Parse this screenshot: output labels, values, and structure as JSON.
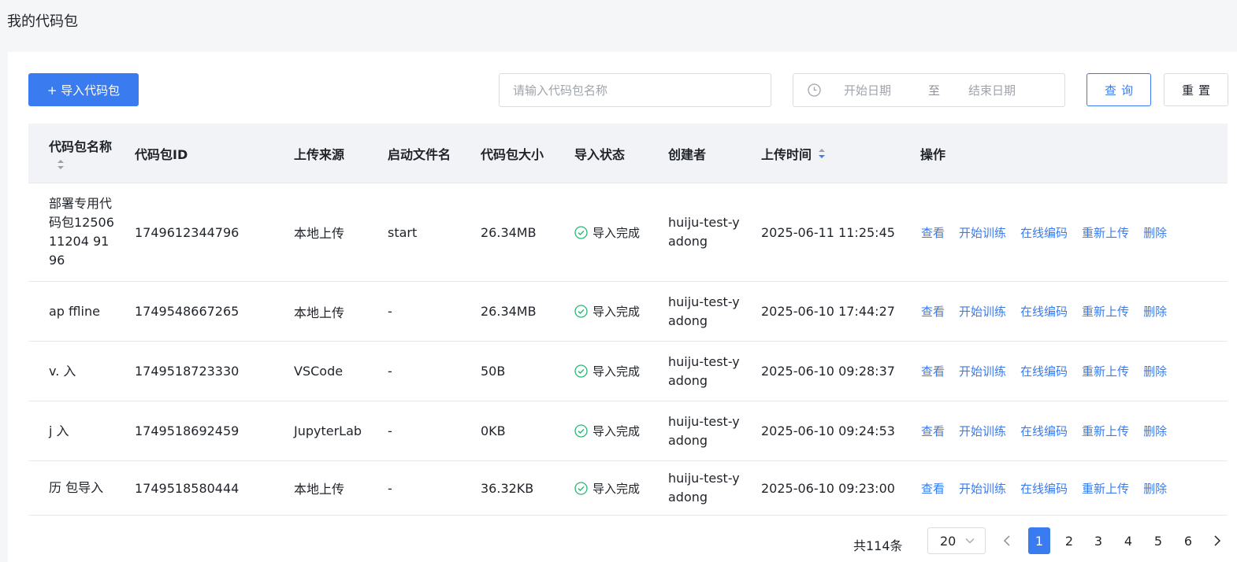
{
  "page": {
    "title": "我的代码包"
  },
  "toolbar": {
    "import_label": "+ 导入代码包",
    "search_placeholder": "请输入代码包名称",
    "date_start_placeholder": "开始日期",
    "date_separator": "至",
    "date_end_placeholder": "结束日期",
    "query_label": "查询",
    "reset_label": "重置"
  },
  "table": {
    "columns": [
      "代码包名称",
      "代码包ID",
      "上传来源",
      "启动文件名",
      "代码包大小",
      "导入状态",
      "创建者",
      "上传时间",
      "操作"
    ],
    "rows": [
      {
        "name": "部署专用代码包1250611204 9196",
        "id": "1749612344796",
        "source": "本地上传",
        "startfile": "start",
        "size": "26.34MB",
        "status": "导入完成",
        "creator": "huiju-test-yadong",
        "time": "2025-06-11 11:25:45"
      },
      {
        "name": "ap  ffline",
        "id": "1749548667265",
        "source": "本地上传",
        "startfile": "-",
        "size": "26.34MB",
        "status": "导入完成",
        "creator": "huiju-test-yadong",
        "time": "2025-06-10 17:44:27"
      },
      {
        "name": "v. 入",
        "id": "1749518723330",
        "source": "VSCode",
        "startfile": "-",
        "size": "50B",
        "status": "导入完成",
        "creator": "huiju-test-yadong",
        "time": "2025-06-10 09:28:37"
      },
      {
        "name": "j 入",
        "id": "1749518692459",
        "source": "JupyterLab",
        "startfile": "-",
        "size": "0KB",
        "status": "导入完成",
        "creator": "huiju-test-yadong",
        "time": "2025-06-10 09:24:53"
      },
      {
        "name": "历 包导入",
        "id": "1749518580444",
        "source": "本地上传",
        "startfile": "-",
        "size": "36.32KB",
        "status": "导入完成",
        "creator": "huiju-test-yadong",
        "time": "2025-06-10 09:23:00"
      }
    ],
    "actions": [
      "查看",
      "开始训练",
      "在线编码",
      "重新上传",
      "删除"
    ]
  },
  "pagination": {
    "total": "共114条",
    "page_size": "20",
    "pages": [
      "1",
      "2",
      "3",
      "4",
      "5",
      "6"
    ],
    "current": "1"
  },
  "colors": {
    "primary": "#3a7bf0",
    "success": "#2bb673",
    "header_bg": "#f1f3f6"
  }
}
